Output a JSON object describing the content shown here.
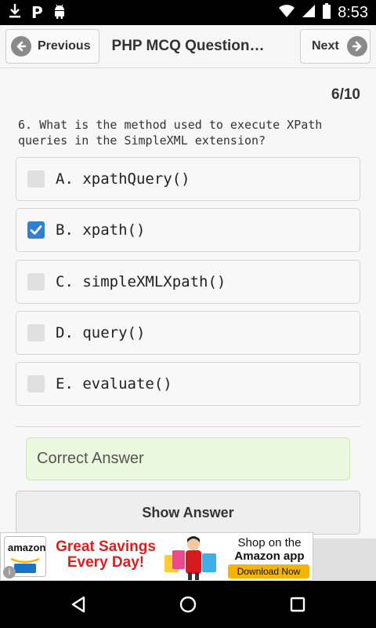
{
  "status_bar": {
    "time": "8:53",
    "left_icons": [
      "download-icon",
      "parking-icon",
      "android-icon"
    ],
    "parking_glyph": "P",
    "right_icons": [
      "wifi-icon",
      "signal-icon",
      "battery-icon"
    ]
  },
  "header": {
    "previous_label": "Previous",
    "title": "PHP MCQ Question…",
    "next_label": "Next"
  },
  "quiz": {
    "counter": "6/10",
    "question": "6. What is the method used to execute XPath queries in the SimpleXML extension?",
    "options": [
      {
        "label": "A. xpathQuery()",
        "checked": false
      },
      {
        "label": "B. xpath()",
        "checked": true
      },
      {
        "label": "C. simpleXMLXpath()",
        "checked": false
      },
      {
        "label": "D. query()",
        "checked": false
      },
      {
        "label": "E. evaluate()",
        "checked": false
      }
    ],
    "result_text": "Correct Answer",
    "show_answer_label": "Show Answer"
  },
  "ad": {
    "logo_text": "amazon",
    "headline": "Great Savings Every Day!",
    "tagline_line1": "Shop on the",
    "tagline_line2": "Amazon app",
    "cta": "Download Now",
    "info_icon": "info-icon"
  },
  "colors": {
    "accent": "#2d80d2",
    "success_bg": "#eaf9dd",
    "ad_red": "#d91f1f",
    "cta_yellow": "#f4b400"
  },
  "nav_bar": {
    "icons": [
      "back-icon",
      "home-icon",
      "recents-icon"
    ]
  }
}
